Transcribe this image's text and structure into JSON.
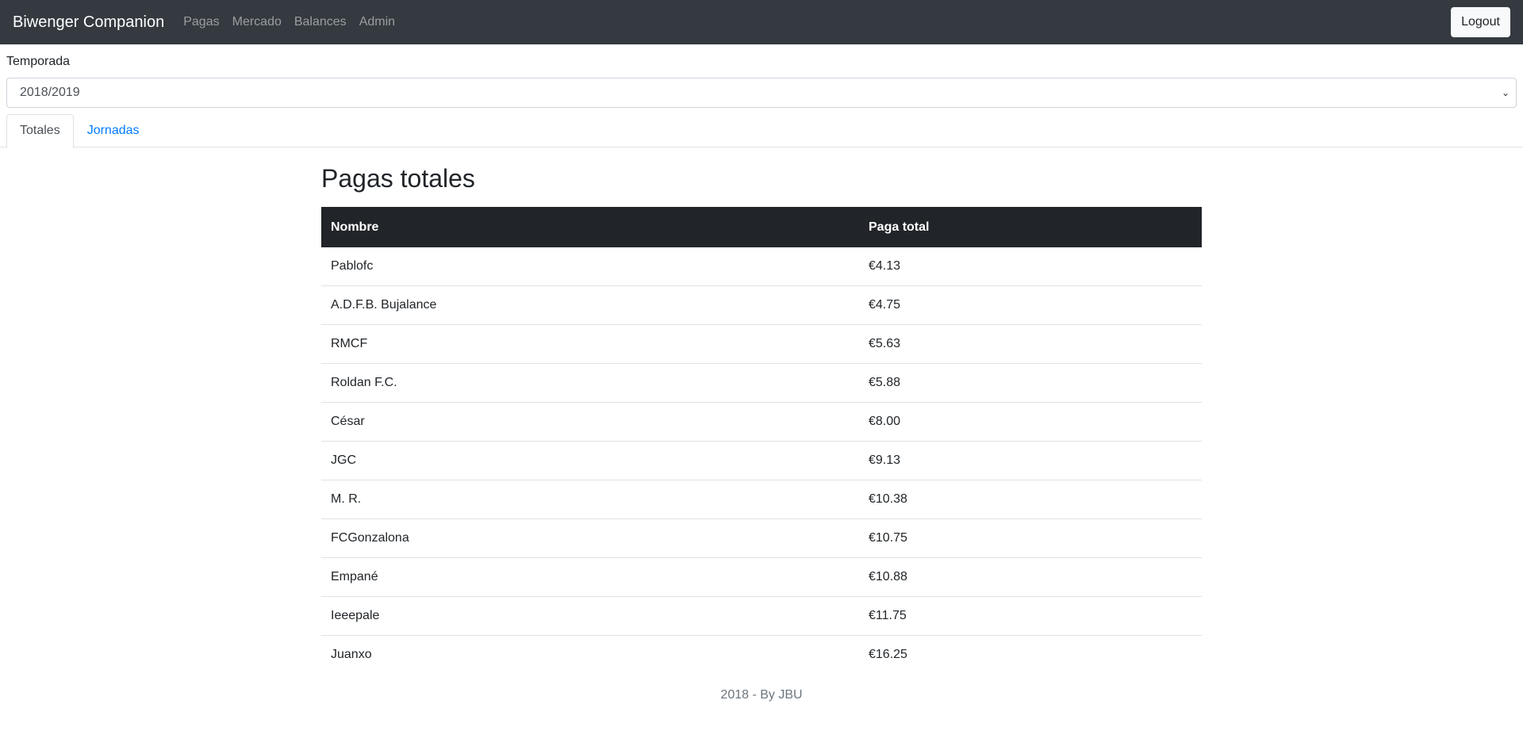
{
  "navbar": {
    "brand": "Biwenger Companion",
    "links": [
      "Pagas",
      "Mercado",
      "Balances",
      "Admin"
    ],
    "logout_label": "Logout"
  },
  "season": {
    "label": "Temporada",
    "selected": "2018/2019"
  },
  "tabs": [
    {
      "label": "Totales",
      "active": true
    },
    {
      "label": "Jornadas",
      "active": false
    }
  ],
  "main": {
    "title": "Pagas totales",
    "table": {
      "headers": [
        "Nombre",
        "Paga total"
      ],
      "rows": [
        {
          "name": "Pablofc",
          "total": "€4.13"
        },
        {
          "name": "A.D.F.B. Bujalance",
          "total": "€4.75"
        },
        {
          "name": "RMCF",
          "total": "€5.63"
        },
        {
          "name": "Roldan F.C.",
          "total": "€5.88"
        },
        {
          "name": "César",
          "total": "€8.00"
        },
        {
          "name": "JGC",
          "total": "€9.13"
        },
        {
          "name": "M. R.",
          "total": "€10.38"
        },
        {
          "name": "FCGonzalona",
          "total": "€10.75"
        },
        {
          "name": "Empané",
          "total": "€10.88"
        },
        {
          "name": "Ieeepale",
          "total": "€11.75"
        },
        {
          "name": "Juanxo",
          "total": "€16.25"
        }
      ]
    }
  },
  "footer": {
    "text": "2018 - By JBU"
  },
  "colors": {
    "navbar_bg": "#343a40",
    "table_header_bg": "#212529",
    "link": "#007bff"
  }
}
